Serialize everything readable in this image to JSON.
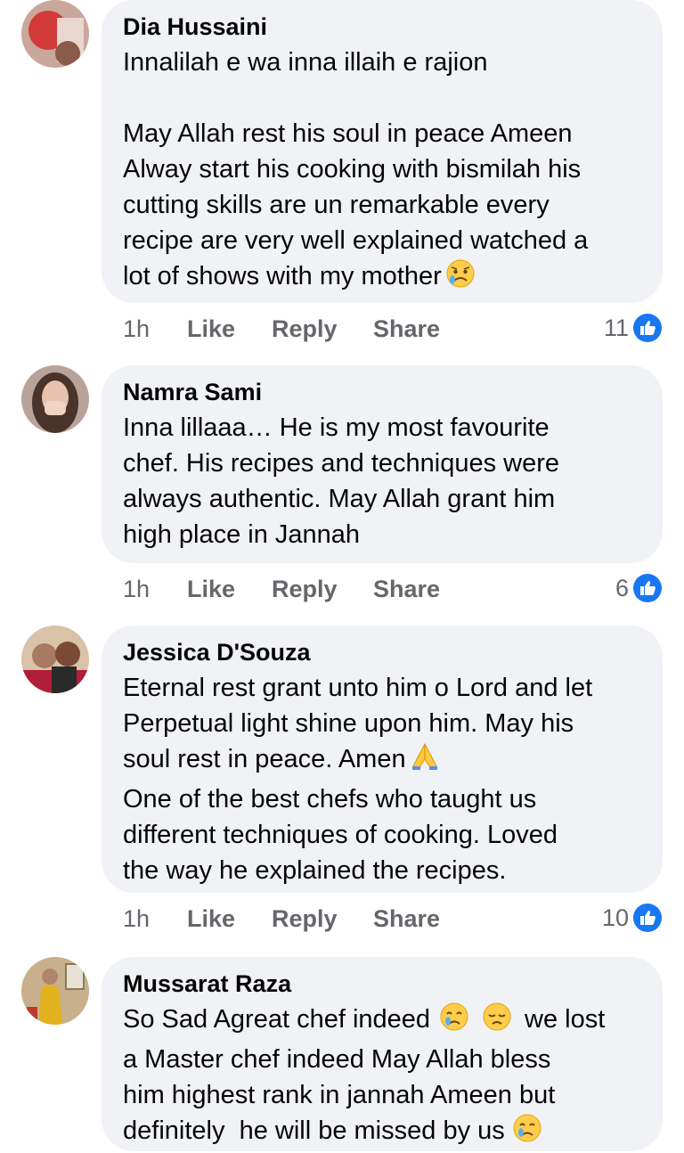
{
  "actions": {
    "like_label": "Like",
    "reply_label": "Reply",
    "share_label": "Share"
  },
  "colors": {
    "bubble_bg": "#f0f2f5",
    "meta_text": "#65676b",
    "like_blue": "#1877f2"
  },
  "comments": [
    {
      "author": "Dia Hussaini",
      "lines": [
        "Innalilah e wa inna illaih e rajion",
        "",
        "May Allah rest his soul in peace Ameen",
        "Alway start his cooking with bismilah his",
        "cutting skills are un remarkable every",
        "recipe are very well explained watched a",
        "lot of shows with my mother"
      ],
      "time": "1h",
      "reaction_count": "11",
      "avatar_icon": "profile-photo"
    },
    {
      "author": "Namra Sami",
      "lines": [
        "Inna lillaaa… He is my most favourite",
        "chef. His recipes and techniques were",
        "always authentic. May Allah grant him",
        "high place in Jannah"
      ],
      "time": "1h",
      "reaction_count": "6",
      "avatar_icon": "profile-photo"
    },
    {
      "author": "Jessica D'Souza",
      "lines": [
        "Eternal rest grant unto him o Lord and let",
        "Perpetual light shine upon him. May his",
        "soul rest in peace. Amen",
        "One of the best chefs who taught us",
        "different techniques of cooking. Loved",
        "the way he explained the recipes."
      ],
      "time": "1h",
      "reaction_count": "10",
      "avatar_icon": "profile-photo"
    },
    {
      "author": "Mussarat Raza",
      "lines": [
        "So Sad Agreat chef indeed",
        "a Master chef indeed May Allah bless",
        "him highest rank in jannah Ameen but",
        "definitely  he will be missed by us"
      ],
      "avatar_icon": "profile-photo"
    }
  ]
}
